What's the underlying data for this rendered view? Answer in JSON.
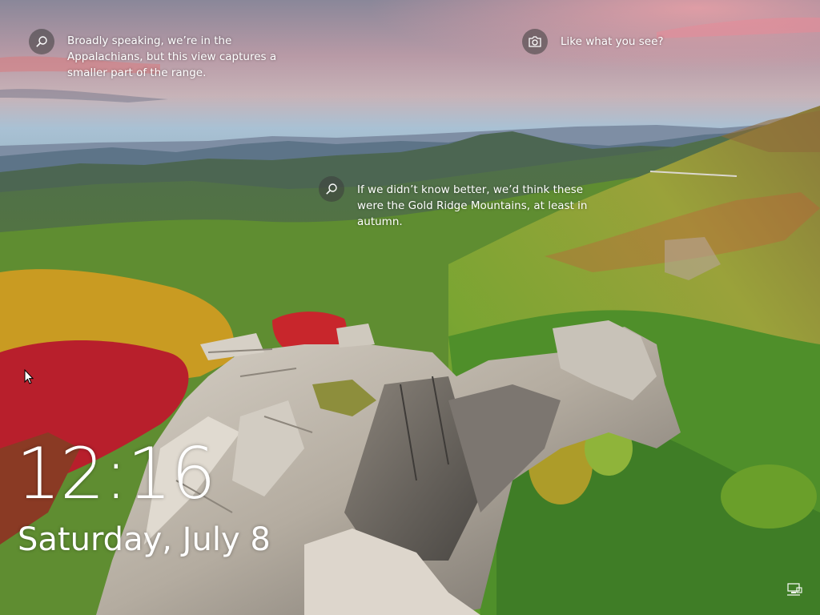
{
  "lockscreen": {
    "hotspots": [
      {
        "icon": "search-icon",
        "text": "Broadly speaking, we’re in the Appalachians, but this view captures a smaller part of the range."
      },
      {
        "icon": "camera-icon",
        "text": "Like what you see?"
      },
      {
        "icon": "search-icon",
        "text": "If we didn’t know better, we’d think these were the Gold Ridge Mountains, at least in autumn."
      }
    ],
    "time": "12:16",
    "date": "Saturday, July 8",
    "network_icon": "network-icon",
    "cursor_icon": "mouse-pointer-icon"
  },
  "colors": {
    "sky_top": "#8f8fa6",
    "sky_pink": "#e8a0a8",
    "hills_green": "#6e9a2e",
    "rock": "#b8b2a8",
    "autumn_red": "#c41d2a",
    "autumn_yellow": "#d8a81e"
  }
}
